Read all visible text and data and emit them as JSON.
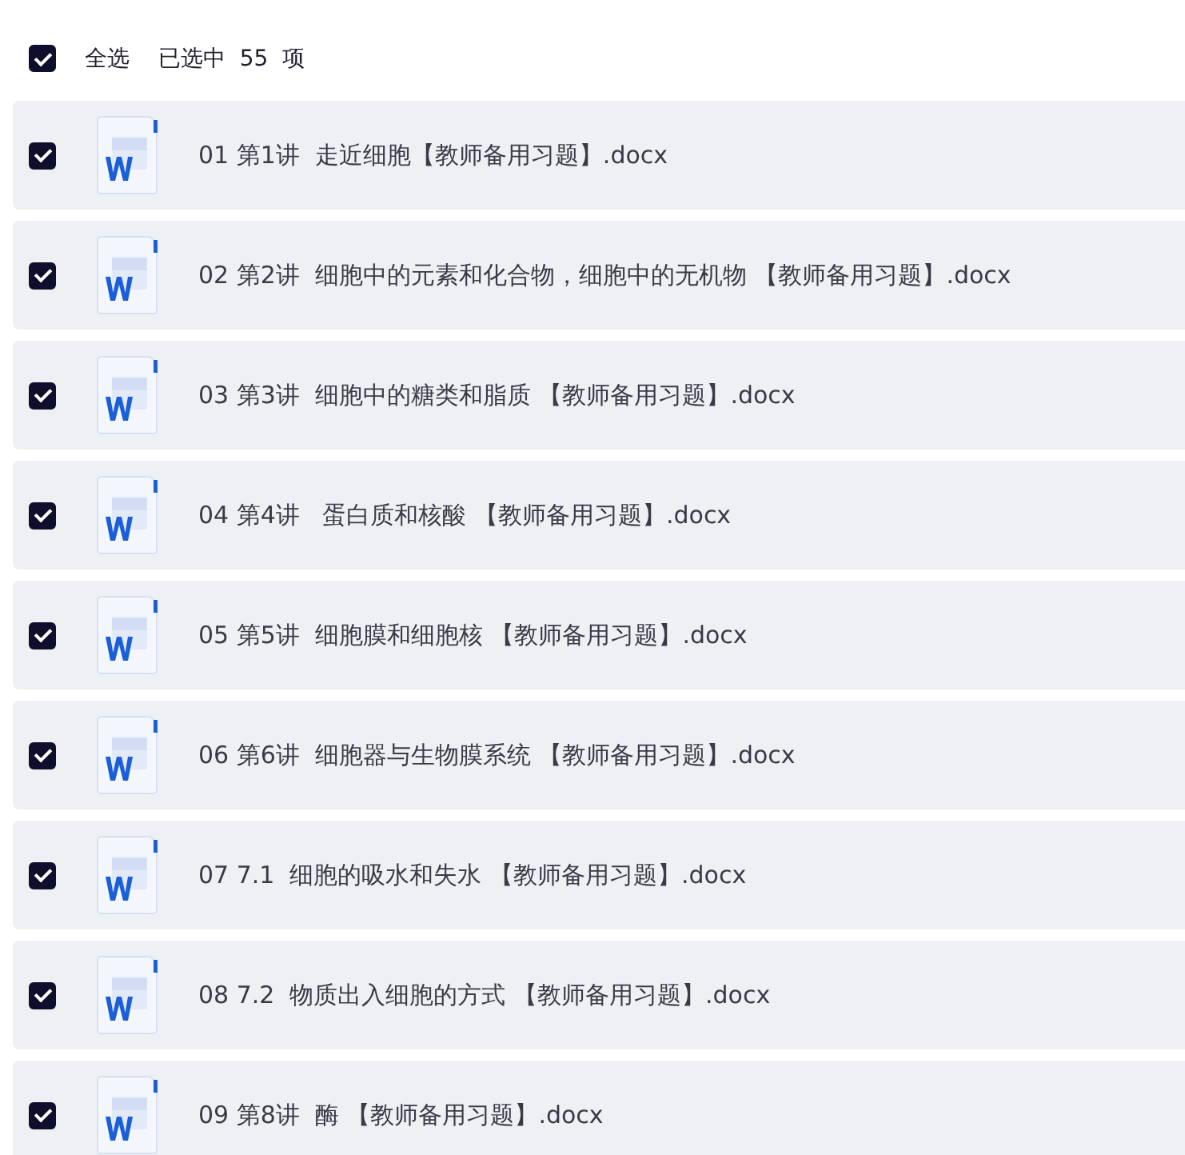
{
  "header": {
    "select_all": {
      "label": "全选",
      "checked": true
    },
    "summary": "已选中  55  项"
  },
  "files": [
    {
      "name": "01 第1讲  走近细胞【教师备用习题】.docx",
      "checked": true
    },
    {
      "name": "02 第2讲  细胞中的元素和化合物，细胞中的无机物 【教师备用习题】.docx",
      "checked": true
    },
    {
      "name": "03 第3讲  细胞中的糖类和脂质 【教师备用习题】.docx",
      "checked": true
    },
    {
      "name": "04 第4讲   蛋白质和核酸 【教师备用习题】.docx",
      "checked": true
    },
    {
      "name": "05 第5讲  细胞膜和细胞核 【教师备用习题】.docx",
      "checked": true
    },
    {
      "name": "06 第6讲  细胞器与生物膜系统 【教师备用习题】.docx",
      "checked": true
    },
    {
      "name": "07 7.1  细胞的吸水和失水 【教师备用习题】.docx",
      "checked": true
    },
    {
      "name": "08 7.2  物质出入细胞的方式 【教师备用习题】.docx",
      "checked": true
    },
    {
      "name": "09 第8讲  酶 【教师备用习题】.docx",
      "checked": true
    }
  ]
}
